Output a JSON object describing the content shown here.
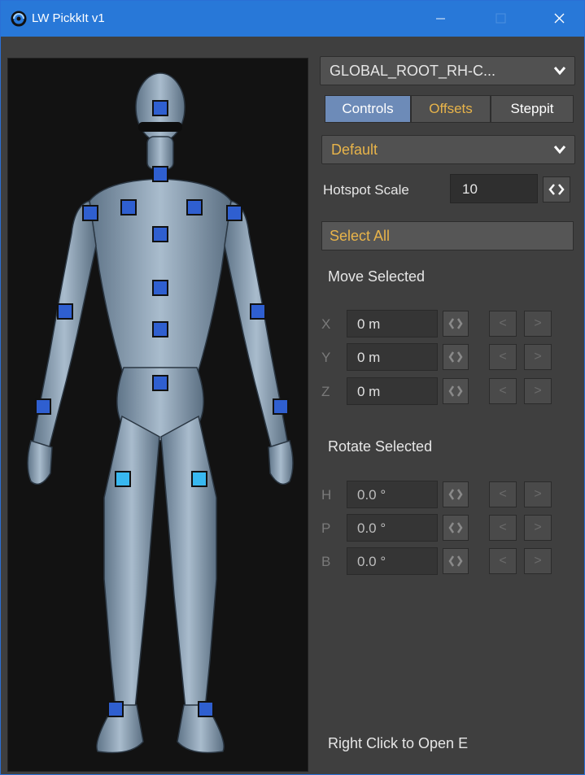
{
  "window": {
    "title": "LW PickkIt v1"
  },
  "panel": {
    "root_dropdown": "GLOBAL_ROOT_RH-C...",
    "tabs": {
      "controls": "Controls",
      "offsets": "Offsets",
      "steppit": "Steppit"
    },
    "preset_dropdown": "Default",
    "hotspot_scale": {
      "label": "Hotspot Scale",
      "value": "10"
    },
    "select_all": "Select All",
    "move": {
      "title": "Move Selected",
      "rows": [
        {
          "axis": "X",
          "value": "0 m"
        },
        {
          "axis": "Y",
          "value": "0 m"
        },
        {
          "axis": "Z",
          "value": "0 m"
        }
      ]
    },
    "rotate": {
      "title": "Rotate Selected",
      "rows": [
        {
          "axis": "H",
          "value": "0.0 °"
        },
        {
          "axis": "P",
          "value": "0.0 °"
        },
        {
          "axis": "B",
          "value": "0.0 °"
        }
      ]
    },
    "nudge": {
      "left": "<",
      "right": ">"
    },
    "hint": "Right Click to Open E"
  },
  "colors": {
    "accent": "#2878d8",
    "hotspot": "#2f5fd0",
    "hotspot_selected": "#38b8f0",
    "highlight_text": "#e8b44a"
  },
  "icons": {
    "app": "swirl-logo-icon",
    "dropdown": "chevron-down-icon",
    "spin": "left-right-arrows-icon"
  }
}
